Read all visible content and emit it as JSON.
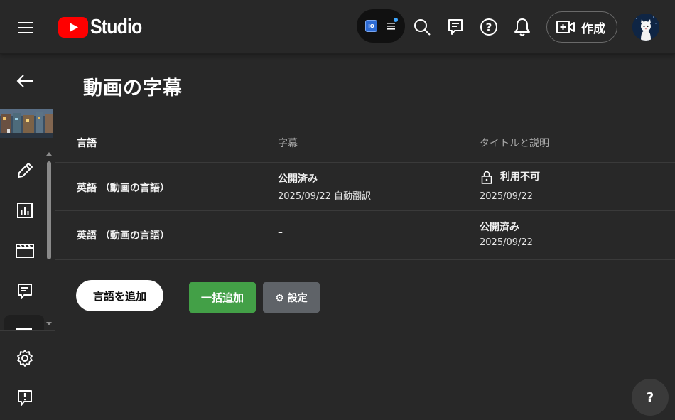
{
  "app": {
    "logo_text": "Studio"
  },
  "topbar": {
    "extension_badge": "IQ",
    "create_label": "作成"
  },
  "page": {
    "title": "動画の字幕"
  },
  "table": {
    "headers": [
      "言語",
      "字幕",
      "タイトルと説明"
    ],
    "rows": [
      {
        "language": "英語 （動画の言語）",
        "subtitles_status": "公開済み",
        "subtitles_detail": "2025/09/22 自動翻訳",
        "title_status": "利用不可",
        "title_date": "2025/09/22"
      },
      {
        "language": "英語 （動画の言語）",
        "subtitles_status": "–",
        "subtitles_detail": "",
        "title_status": "公開済み",
        "title_date": "2025/09/22"
      }
    ]
  },
  "actions": {
    "add_language": "言語を追加",
    "bulk_add": "一括追加",
    "settings": "⚙ 設定"
  },
  "help_fab": "?",
  "colors": {
    "background": "#282828",
    "youtube_red": "#ff0000",
    "bulk_green": "#43a047",
    "settings_gray": "#5f6368"
  }
}
